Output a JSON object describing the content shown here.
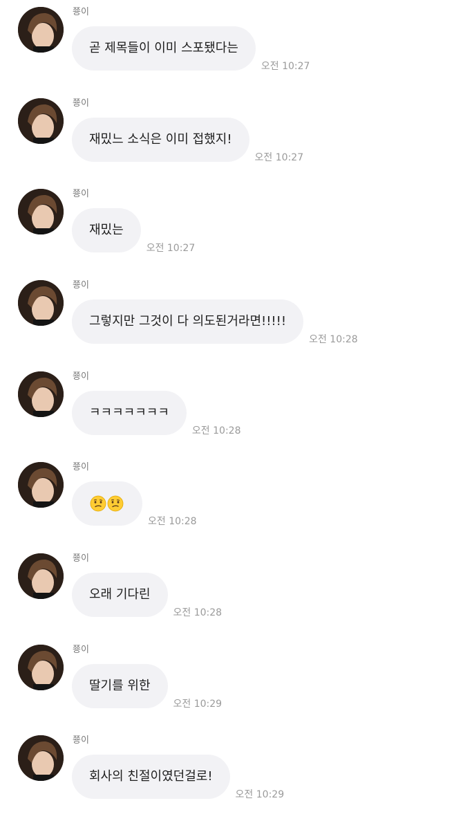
{
  "colors": {
    "bubble": "#f2f2f5",
    "name": "#7a7a7a",
    "time": "#9a9a9a",
    "text": "#1e1e1e"
  },
  "messages": [
    {
      "sender": "쭁이",
      "text": "곧 제목들이 이미 스포됐다는",
      "time": "오전 10:27"
    },
    {
      "sender": "쭁이",
      "text": "재밌느 소식은 이미 접했지!",
      "time": "오전 10:27"
    },
    {
      "sender": "쭁이",
      "text": "재밌는",
      "time": "오전 10:27"
    },
    {
      "sender": "쭁이",
      "text": "그렇지만 그것이 다 의도된거라면!!!!!",
      "time": "오전 10:28"
    },
    {
      "sender": "쭁이",
      "text": "ㅋㅋㅋㅋㅋㅋㅋ",
      "time": "오전 10:28"
    },
    {
      "sender": "쭁이",
      "emoji": [
        "confused-face-icon",
        "confused-face-icon"
      ],
      "time": "오전 10:28"
    },
    {
      "sender": "쭁이",
      "text": "오래 기다린",
      "time": "오전 10:28"
    },
    {
      "sender": "쭁이",
      "text": "딸기를 위한",
      "time": "오전 10:29"
    },
    {
      "sender": "쭁이",
      "text": "회사의 친절이였던걸로!",
      "time": "오전 10:29"
    }
  ]
}
